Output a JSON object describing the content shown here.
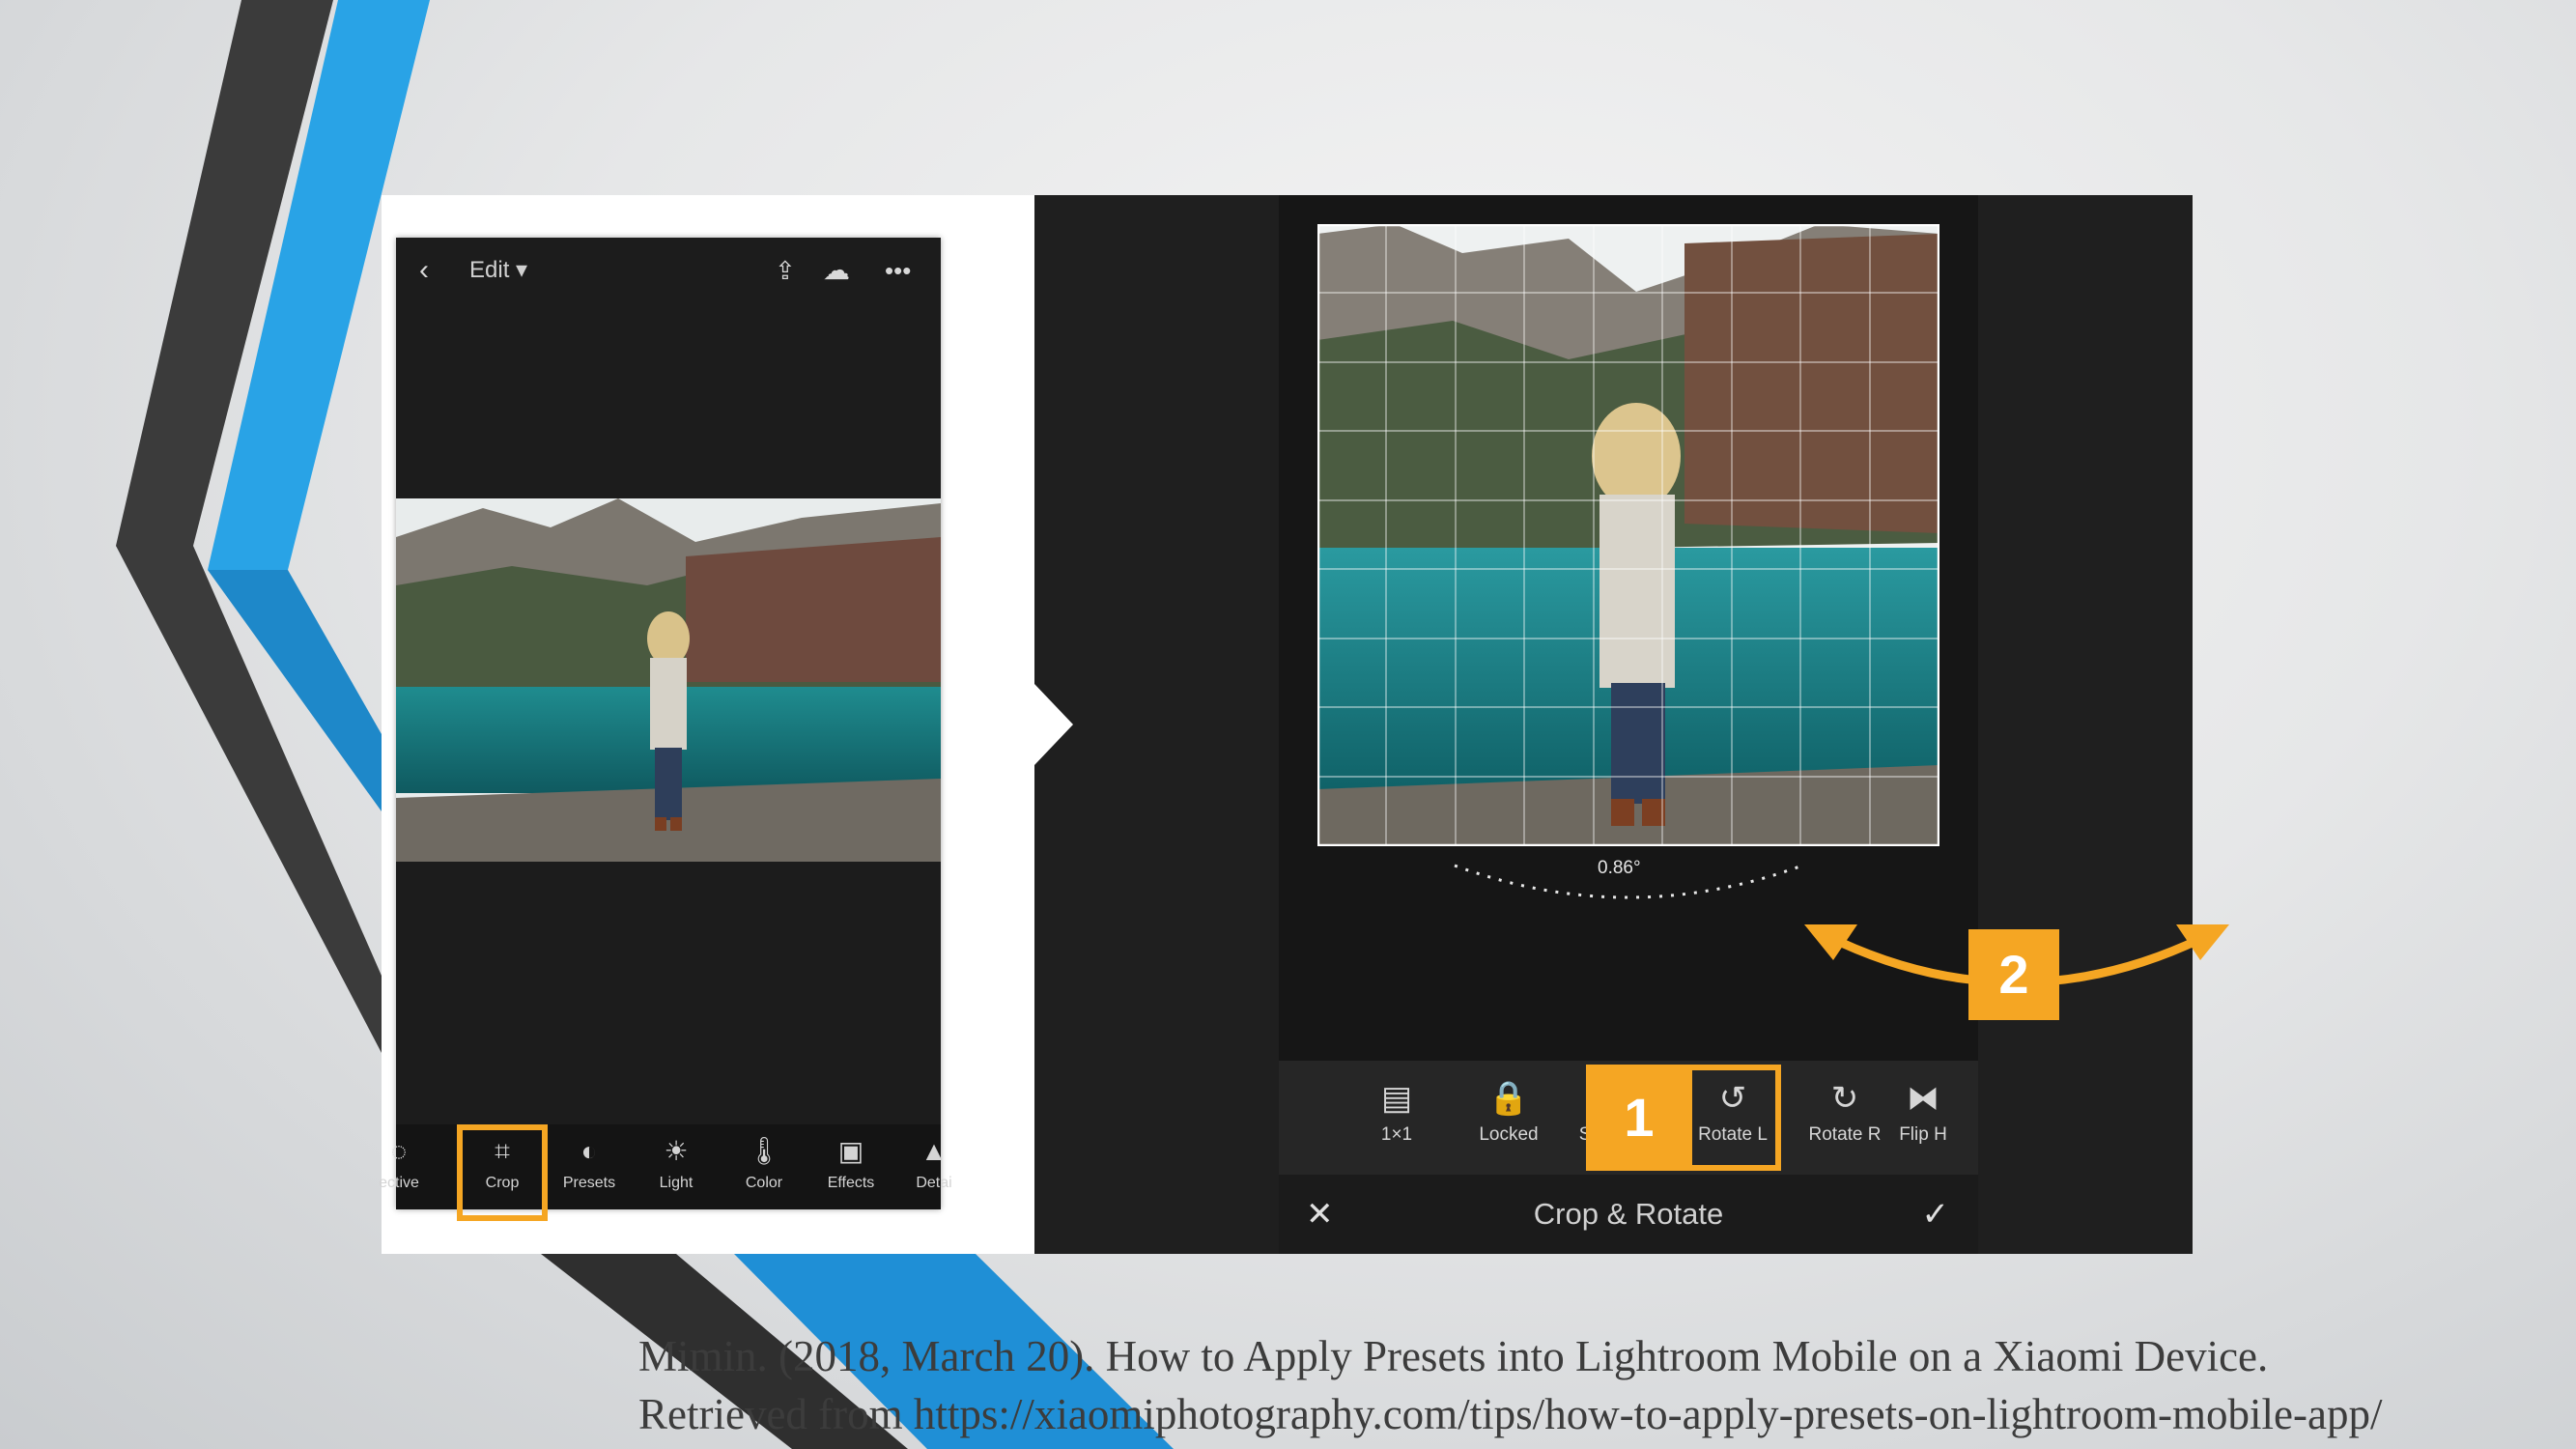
{
  "phone": {
    "back_icon": "chevron-left-icon",
    "edit_label": "Edit ▾",
    "top_icons": [
      "share-icon",
      "cloud-sync-icon",
      "more-icon"
    ],
    "tools": [
      {
        "label": "ective",
        "icon": "selective-icon"
      },
      {
        "label": "Crop",
        "icon": "crop-icon"
      },
      {
        "label": "Presets",
        "icon": "presets-icon"
      },
      {
        "label": "Light",
        "icon": "light-icon"
      },
      {
        "label": "Color",
        "icon": "color-icon"
      },
      {
        "label": "Effects",
        "icon": "effects-icon"
      },
      {
        "label": "Detai",
        "icon": "detail-icon"
      }
    ]
  },
  "crop_editor": {
    "angle": "0.86°",
    "tools": [
      {
        "label": "1×1",
        "icon": "aspect-ratio-icon"
      },
      {
        "label": "Locked",
        "icon": "lock-icon"
      },
      {
        "label": "Straighten",
        "icon": "straighten-icon"
      },
      {
        "label": "Rotate L",
        "icon": "rotate-left-icon"
      },
      {
        "label": "Rotate R",
        "icon": "rotate-right-icon"
      },
      {
        "label": "Flip H",
        "icon": "flip-horizontal-icon"
      }
    ],
    "title": "Crop & Rotate",
    "cancel_icon": "close-icon",
    "confirm_icon": "check-icon"
  },
  "callouts": {
    "step1": "1",
    "step2": "2",
    "accent": "#f5a623"
  },
  "citation": {
    "line1": "Mimin. (2018, March 20). How to Apply Presets into Lightroom Mobile on a Xiaomi Device.",
    "line2": "Retrieved from https://xiaomiphotography.com/tips/how-to-apply-presets-on-lightroom-mobile-app/"
  },
  "colors": {
    "blue_stripe": "#29a3e6",
    "dark_stripe": "#3b3b3b",
    "highlight": "#f5a623"
  }
}
